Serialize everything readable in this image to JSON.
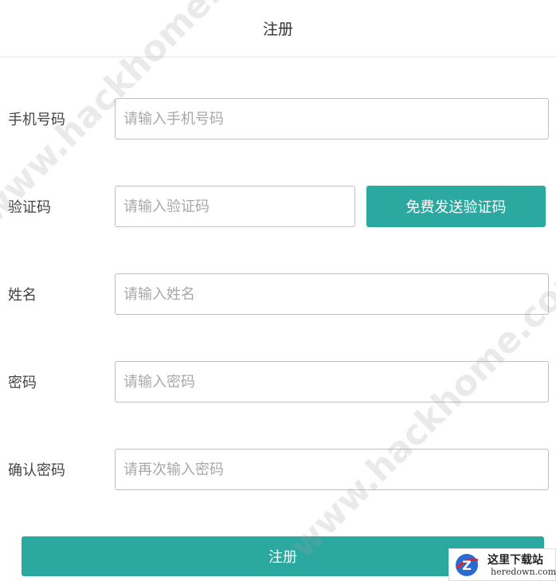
{
  "header": {
    "title": "注册"
  },
  "form": {
    "phone": {
      "label": "手机号码",
      "placeholder": "请输入手机号码",
      "value": ""
    },
    "code": {
      "label": "验证码",
      "placeholder": "请输入验证码",
      "value": "",
      "send_button": "免费发送验证码"
    },
    "name": {
      "label": "姓名",
      "placeholder": "请输入姓名",
      "value": ""
    },
    "password": {
      "label": "密码",
      "placeholder": "请输入密码",
      "value": ""
    },
    "confirm": {
      "label": "确认密码",
      "placeholder": "请再次输入密码",
      "value": ""
    },
    "submit_label": "注册"
  },
  "watermark": {
    "text": "www.hackhome.com"
  },
  "logo": {
    "cn": "这里下载站",
    "en": "heredown.com",
    "letter": "Z"
  },
  "colors": {
    "accent": "#2ba8a0",
    "border": "#bfbfbf",
    "placeholder": "#a8a8a8"
  }
}
